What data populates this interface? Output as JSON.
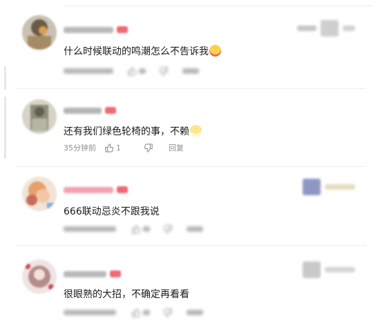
{
  "comments": [
    {
      "text": "什么时候联动的鸣潮怎么不告诉我",
      "emoji": "face-with-hand-over-mouth-emoji",
      "time": "",
      "likes": "",
      "reply_label": ""
    },
    {
      "text": "还有我们绿色轮椅的事，不赖",
      "emoji": "grin-emoji",
      "time": "35分钟前",
      "likes": "1",
      "reply_label": "回复"
    },
    {
      "text": "666联动忌炎不跟我说",
      "emoji": "",
      "time": "",
      "likes": "",
      "reply_label": ""
    },
    {
      "text": "很眼熟的大招，不确定再看看",
      "emoji": "",
      "time": "",
      "likes": "",
      "reply_label": ""
    }
  ],
  "colors": {
    "username_pink": "#f2a0b0",
    "badge_red": "#f06a73",
    "meta_gray": "#8f8f8f"
  }
}
